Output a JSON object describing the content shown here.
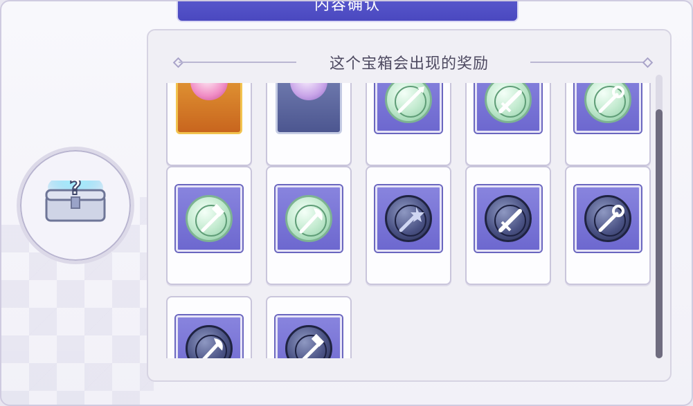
{
  "dialog": {
    "title": "内容确认"
  },
  "panel": {
    "header": "这个宝箱会出现的奖励"
  },
  "chest": {
    "icon": "mystery-chest-icon"
  },
  "rewards": [
    {
      "icon": "pink-sword-gem-card-icon",
      "frame": "gold"
    },
    {
      "icon": "purple-cross-gem-card-icon",
      "frame": "blue"
    },
    {
      "icon": "green-spear-coin-icon",
      "color": "green"
    },
    {
      "icon": "green-sword-coin-icon",
      "color": "green"
    },
    {
      "icon": "green-staff-coin-icon",
      "color": "green"
    },
    {
      "icon": "green-hammer-coin-icon",
      "color": "green"
    },
    {
      "icon": "green-axe-coin-icon",
      "color": "green"
    },
    {
      "icon": "dark-wand-coin-icon",
      "color": "dark"
    },
    {
      "icon": "dark-sword-coin-icon",
      "color": "dark"
    },
    {
      "icon": "dark-staff-coin-icon",
      "color": "dark"
    },
    {
      "icon": "dark-axe-coin-icon",
      "color": "dark"
    },
    {
      "icon": "dark-hammer-coin-icon",
      "color": "dark"
    }
  ],
  "colors": {
    "accent": "#4f4dc4",
    "panel": "#f0eff5"
  }
}
